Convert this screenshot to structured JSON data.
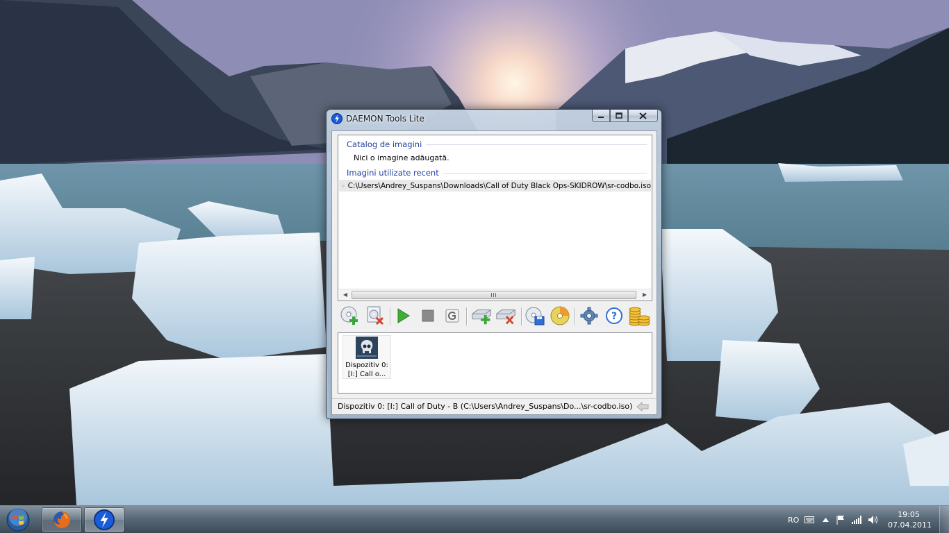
{
  "window": {
    "title": "DAEMON Tools Lite",
    "minimize_label": "—",
    "maximize_label": "▢",
    "close_label": "✕"
  },
  "catalog": {
    "header": "Catalog de imagini",
    "empty_text": "Nici o imagine adăugată.",
    "recent_header": "Imagini utilizate recent",
    "recent_items": [
      {
        "path": "C:\\Users\\Andrey_Suspans\\Downloads\\Call of Duty Black Ops-SKIDROW\\sr-codbo.iso",
        "icon": "cd-icon"
      }
    ]
  },
  "toolbar": {
    "buttons": [
      {
        "name": "add-image-button",
        "icon": "add-image-icon"
      },
      {
        "name": "remove-image-button",
        "icon": "remove-image-icon"
      },
      {
        "name": "mount-button",
        "icon": "play-icon"
      },
      {
        "name": "unmount-button",
        "icon": "stop-icon"
      },
      {
        "name": "unmount-all-button",
        "icon": "g-icon"
      },
      {
        "name": "add-drive-button",
        "icon": "add-drive-icon"
      },
      {
        "name": "remove-drive-button",
        "icon": "remove-drive-icon"
      },
      {
        "name": "make-image-button",
        "icon": "disc-save-icon"
      },
      {
        "name": "burn-image-button",
        "icon": "burn-disc-icon"
      },
      {
        "name": "preferences-button",
        "icon": "gear-icon"
      },
      {
        "name": "help-button",
        "icon": "help-icon"
      },
      {
        "name": "buy-button",
        "icon": "coins-icon"
      }
    ]
  },
  "devices": [
    {
      "line1": "Dispozitiv 0:",
      "line2": "[I:] Call o...",
      "icon": "black-ops-skull-icon"
    }
  ],
  "status": {
    "text": "Dispozitiv 0: [I:] Call of Duty - B (C:\\Users\\Andrey_Suspans\\Do...\\sr-codbo.iso)"
  },
  "taskbar": {
    "language": "RO",
    "time": "19:05",
    "date": "07.04.2011",
    "apps": [
      {
        "name": "firefox",
        "icon": "firefox-icon"
      },
      {
        "name": "daemon-tools",
        "icon": "daemon-tools-icon"
      }
    ]
  },
  "colors": {
    "group_header": "#1e3f9e",
    "selected_row": "#e9e9e9"
  }
}
